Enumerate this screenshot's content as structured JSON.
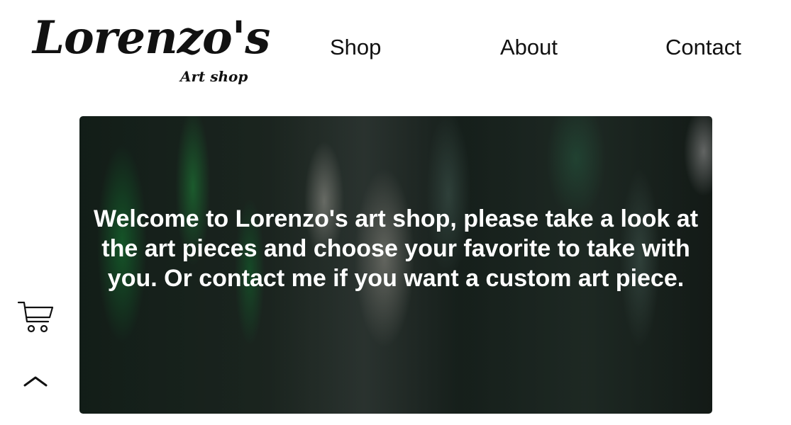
{
  "header": {
    "logo_title": "Lorenzo's",
    "logo_subtitle": "Art shop",
    "nav": {
      "shop": "Shop",
      "about": "About",
      "contact": "Contact"
    }
  },
  "hero": {
    "message": "Welcome to Lorenzo's art shop, please take a look at the art pieces and choose your favorite to take with you. Or contact me if you want a custom art piece."
  },
  "floating_buttons": {
    "cart_icon": "shopping-cart-icon",
    "scroll_top_icon": "chevron-up-icon"
  },
  "colors": {
    "text": "#111111",
    "hero_text": "#ffffff",
    "background": "#ffffff"
  }
}
